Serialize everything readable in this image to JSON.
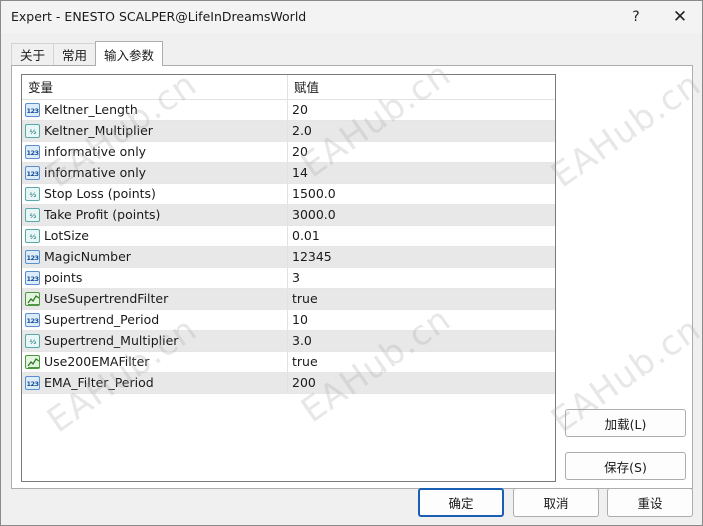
{
  "window": {
    "title": "Expert - ENESTO SCALPER@LifeInDreamsWorld",
    "help_label": "?",
    "close_label": "✕"
  },
  "tabs": [
    {
      "label": "关于",
      "active": false
    },
    {
      "label": "常用",
      "active": false
    },
    {
      "label": "输入参数",
      "active": true
    }
  ],
  "grid": {
    "headers": {
      "variable": "变量",
      "value": "赋值"
    },
    "rows": [
      {
        "type": "int",
        "icon": "integer-type-icon",
        "name": "Keltner_Length",
        "value": "20"
      },
      {
        "type": "dbl",
        "icon": "double-type-icon",
        "name": "Keltner_Multiplier",
        "value": "2.0"
      },
      {
        "type": "int",
        "icon": "integer-type-icon",
        "name": "informative only",
        "value": "20"
      },
      {
        "type": "int",
        "icon": "integer-type-icon",
        "name": "informative only",
        "value": "14"
      },
      {
        "type": "dbl",
        "icon": "double-type-icon",
        "name": "Stop Loss (points)",
        "value": "1500.0"
      },
      {
        "type": "dbl",
        "icon": "double-type-icon",
        "name": "Take Profit (points)",
        "value": "3000.0"
      },
      {
        "type": "dbl",
        "icon": "double-type-icon",
        "name": "LotSize",
        "value": "0.01"
      },
      {
        "type": "int",
        "icon": "integer-type-icon",
        "name": "MagicNumber",
        "value": "12345"
      },
      {
        "type": "int",
        "icon": "integer-type-icon",
        "name": "points",
        "value": "3"
      },
      {
        "type": "bool",
        "icon": "boolean-type-icon",
        "name": "UseSupertrendFilter",
        "value": "true"
      },
      {
        "type": "int",
        "icon": "integer-type-icon",
        "name": "Supertrend_Period",
        "value": "10"
      },
      {
        "type": "dbl",
        "icon": "double-type-icon",
        "name": "Supertrend_Multiplier",
        "value": "3.0"
      },
      {
        "type": "bool",
        "icon": "boolean-type-icon",
        "name": "Use200EMAFilter",
        "value": "true"
      },
      {
        "type": "int",
        "icon": "integer-type-icon",
        "name": "EMA_Filter_Period",
        "value": "200"
      }
    ]
  },
  "icon_text": {
    "int": "123",
    "dbl": "½"
  },
  "buttons": {
    "load": "加载(L)",
    "save": "保存(S)",
    "ok": "确定",
    "cancel": "取消",
    "reset": "重设"
  },
  "watermark": "EAHub.cn",
  "colors": {
    "accent": "#1a5fb4",
    "row_alt": "#e8e8e8",
    "border": "#adadad"
  }
}
